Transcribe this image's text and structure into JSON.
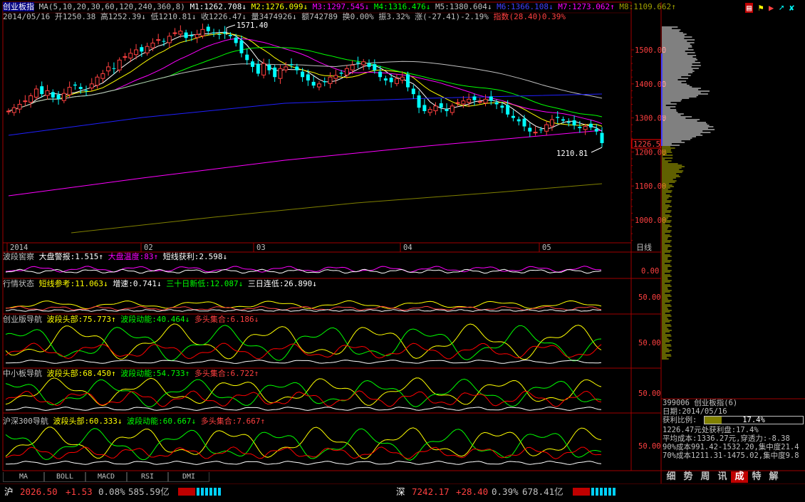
{
  "header": {
    "index_name": "创业板指",
    "ma_params": "MA(5,10,20,30,60,120,240,360,8)",
    "m1": "M1:1262.708",
    "m2": "M2:1276.099",
    "m3": "M3:1297.545",
    "m4": "M4:1316.476",
    "m5": "M5:1380.604",
    "m6": "M6:1366.108",
    "m7": "M7:1273.062",
    "m8": "M8:1109.662",
    "arrow_down": "↓",
    "arrow_up": "↑",
    "date": "2014/05/16",
    "open": "开1250.38",
    "high": "高1252.39",
    "low": "低1210.81",
    "close": "收1226.47",
    "vol": "量3474926",
    "amount": "额742789",
    "turnover": "换0.00%",
    "amplitude": "振3.32%",
    "change": "涨(-27.41)-2.19%",
    "index_label": "指数",
    "index_val": "(28.40)0.39%"
  },
  "main_chart": {
    "high_marker": "1571.40",
    "low_marker": "1210.81",
    "current_price": "1226.5",
    "y_ticks": [
      "1500.00",
      "1400.00",
      "1300.00",
      "1200.00",
      "1100.00",
      "1000.00"
    ],
    "x_ticks": [
      "2014",
      "02",
      "03",
      "04",
      "05"
    ],
    "period_label": "日线"
  },
  "indicators": {
    "p1": {
      "name": "波段窖察",
      "a": "大盘警报:1.515",
      "b": "大盘温度:83",
      "c": "短线获利:2.598",
      "tick": "0.00"
    },
    "p2": {
      "name": "行情状态",
      "a": "短线参考:11.063",
      "b": "增速:0.741",
      "c": "三十日新低:12.087",
      "d": "三日连低:26.890",
      "tick": "50.00"
    },
    "p3": {
      "name": "创业版导航",
      "a": "波段头部:75.773",
      "b": "波段动能:40.464",
      "c": "多头集合:6.186",
      "tick": "50.00"
    },
    "p4": {
      "name": "中小板导航",
      "a": "波段头部:68.450",
      "b": "波段动能:54.733",
      "c": "多头集合:6.722",
      "tick": "50.00"
    },
    "p5": {
      "name": "沪深300导航",
      "a": "波段头部:60.333",
      "b": "波段动能:60.667",
      "c": "多头集合:7.667",
      "tick": "50.00"
    }
  },
  "tabs": [
    "MA",
    "BOLL",
    "MACD",
    "RSI",
    "DMI"
  ],
  "right_panel": {
    "code_name": "399006 创业板指(6)",
    "date": "日期:2014/05/16",
    "profit_ratio_label": "获利比例:",
    "profit_ratio_value": "17.4%",
    "line1": "1226.47元处获利盘:17.4%",
    "line2": "平均成本:1336.27元,穿透力:-8.38",
    "line3": "90%成本991.42-1532.20,集中度21.4",
    "line4": "70%成本1211.31-1475.02,集中度9.8",
    "bottom_tabs": [
      "细",
      "势",
      "周",
      "讯",
      "成",
      "特",
      "解"
    ]
  },
  "status_bar": {
    "sh_label": "沪",
    "sh_price": "2026.50",
    "sh_change": "+1.53",
    "sh_pct": "0.08%",
    "sh_amount": "585.59亿",
    "sz_label": "深",
    "sz_price": "7242.17",
    "sz_change": "+28.40",
    "sz_pct": "0.39%",
    "sz_amount": "678.41亿"
  },
  "colors": {
    "up": "#ff4040",
    "down": "#00ffff",
    "ma5": "#ffffff",
    "ma10": "#ffff00",
    "ma20": "#ff00ff",
    "ma30": "#00ff00",
    "ma60": "#c0c0c0",
    "ma120": "#0000ff",
    "ma240": "#ff00ff",
    "ma360": "#808000"
  }
}
